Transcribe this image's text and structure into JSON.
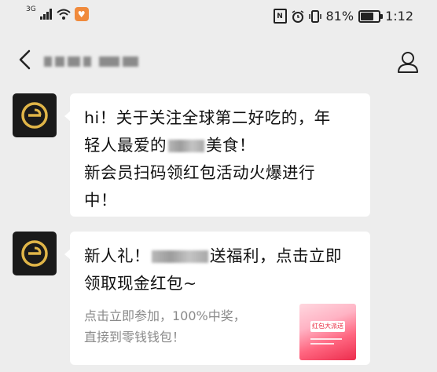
{
  "status_bar": {
    "network": "3G",
    "battery_text": "81%",
    "battery_level": 0.81,
    "time": "1:12"
  },
  "nav": {
    "back_icon": "chevron-left-icon",
    "profile_icon": "person-icon"
  },
  "messages": [
    {
      "avatar_icon": "brand-logo-icon",
      "line1": "hi！关于关注全球第二好吃的，年",
      "line2_before": "轻人最爱的",
      "line2_after": "美食！",
      "line3": "新会员扫码领红包活动火爆进行",
      "line4": "中！"
    },
    {
      "avatar_icon": "brand-logo-icon",
      "line1_before": "新人礼！",
      "line1_after": "送福利，点击立即",
      "line2": "领取现金红包~",
      "desc_line1": "点击立即参加，100%中奖，",
      "desc_line2": "直接到零钱钱包！",
      "thumb_label": "红包大派送"
    }
  ],
  "colors": {
    "background": "#ededed",
    "bubble": "#ffffff",
    "desc_text": "#8a8a8a",
    "accent_red": "#ec2d4d"
  }
}
